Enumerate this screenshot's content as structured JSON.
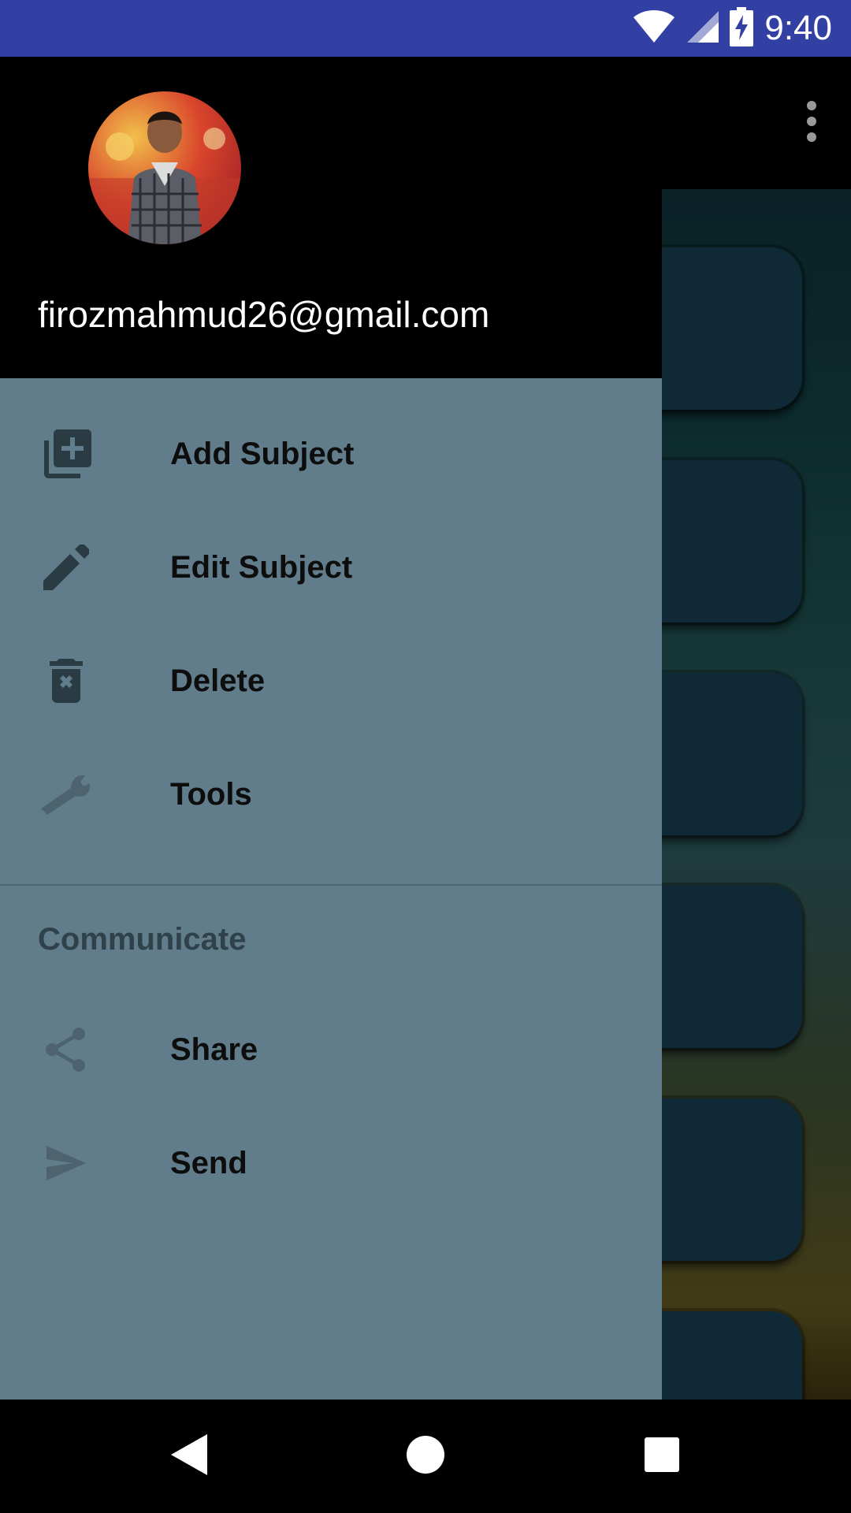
{
  "status_bar": {
    "time": "9:40",
    "icons": [
      "wifi-icon",
      "cell-signal-icon",
      "battery-charging-icon"
    ],
    "background": "#3240a4"
  },
  "drawer": {
    "account_email": "firozmahmud26@gmail.com",
    "background": "#617d8b",
    "items": [
      {
        "label": "Add Subject",
        "icon": "add-box-multiple-icon"
      },
      {
        "label": "Edit Subject",
        "icon": "pencil-icon"
      },
      {
        "label": "Delete",
        "icon": "delete-forever-icon"
      },
      {
        "label": "Tools",
        "icon": "wrench-icon"
      }
    ],
    "section": {
      "title": "Communicate",
      "items": [
        {
          "label": "Share",
          "icon": "share-icon"
        },
        {
          "label": "Send",
          "icon": "send-icon"
        }
      ]
    }
  },
  "app_bar": {
    "overflow_icon": "more-vert-icon"
  },
  "nav_bar": {
    "buttons": [
      "back-icon",
      "home-icon",
      "recents-icon"
    ]
  }
}
